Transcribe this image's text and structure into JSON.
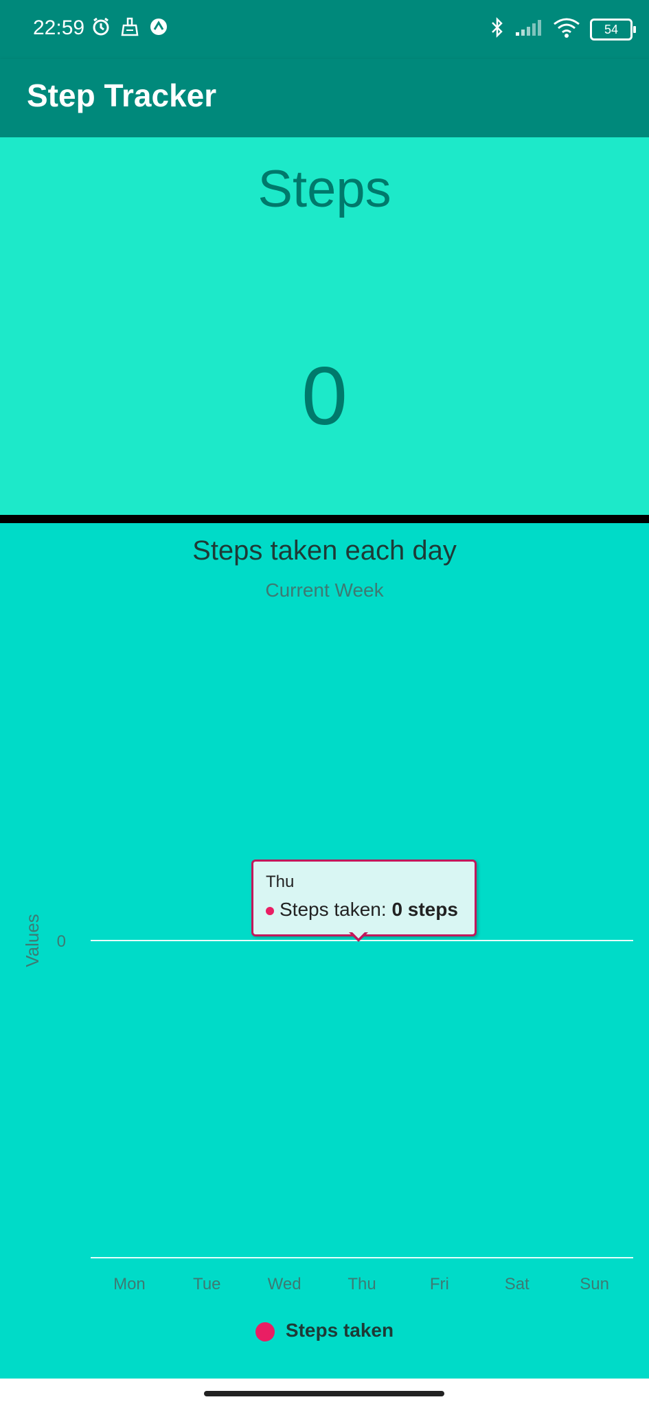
{
  "status_bar": {
    "time": "22:59",
    "battery": "54",
    "left_icons": [
      "alarm-icon",
      "cleaner-icon",
      "app-notification-icon"
    ],
    "right_icons": [
      "bluetooth-icon",
      "signal-icon",
      "wifi-icon",
      "battery-icon"
    ]
  },
  "app_bar": {
    "title": "Step Tracker"
  },
  "steps_panel": {
    "label": "Steps",
    "count": "0"
  },
  "chart": {
    "tooltip": {
      "day": "Thu",
      "series_label": "Steps taken: ",
      "value_text": "0 steps"
    },
    "legend": {
      "label": "Steps taken"
    }
  },
  "chart_data": {
    "type": "line",
    "title": "Steps taken each day",
    "subtitle": "Current Week",
    "categories": [
      "Mon",
      "Tue",
      "Wed",
      "Thu",
      "Fri",
      "Sat",
      "Sun"
    ],
    "series": [
      {
        "name": "Steps taken",
        "values": [
          0,
          0,
          0,
          0,
          0,
          0,
          0
        ],
        "color": "#e91e63"
      }
    ],
    "xlabel": "",
    "ylabel": "Values",
    "y_ticks": [
      "0"
    ],
    "grid": true,
    "legend_position": "bottom"
  },
  "colors": {
    "primary": "#00897b",
    "steps_background": "#1de9c9",
    "chart_background": "#00dbc8",
    "accent": "#e91e63"
  }
}
